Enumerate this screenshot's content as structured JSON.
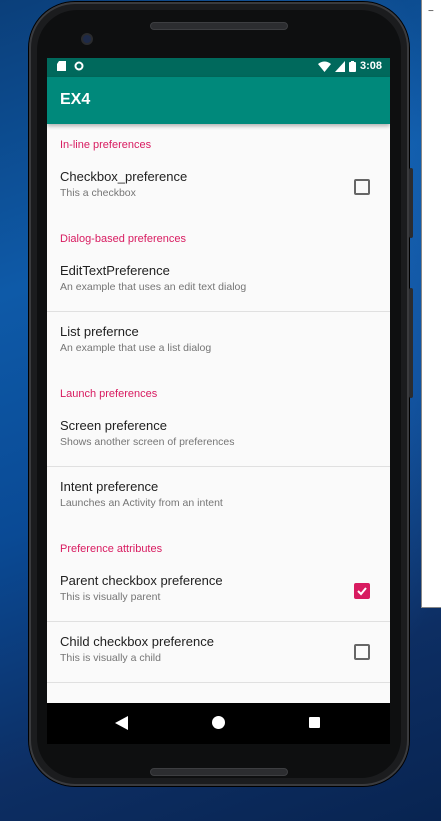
{
  "status_bar": {
    "time": "3:08"
  },
  "app_bar": {
    "title": "EX4"
  },
  "preferences": [
    {
      "type": "category",
      "label": "In-line preferences"
    },
    {
      "type": "item",
      "title": "Checkbox_preference",
      "summary": "This a checkbox",
      "checkbox": true,
      "checked": false,
      "divider": false
    },
    {
      "type": "category",
      "label": "Dialog-based preferences"
    },
    {
      "type": "item",
      "title": "EditTextPreference",
      "summary": "An example that uses an edit text dialog",
      "checkbox": false,
      "divider": true
    },
    {
      "type": "item",
      "title": "List prefernce",
      "summary": "An example that use a list dialog",
      "checkbox": false,
      "divider": false
    },
    {
      "type": "category",
      "label": "Launch preferences"
    },
    {
      "type": "item",
      "title": "Screen preference",
      "summary": "Shows another screen of preferences",
      "checkbox": false,
      "divider": true
    },
    {
      "type": "item",
      "title": "Intent preference",
      "summary": "Launches an Activity from an intent",
      "checkbox": false,
      "divider": false
    },
    {
      "type": "category",
      "label": "Preference attributes"
    },
    {
      "type": "item",
      "title": "Parent checkbox preference",
      "summary": "This is visually parent",
      "checkbox": true,
      "checked": true,
      "divider": true
    },
    {
      "type": "item",
      "title": "Child checkbox preference",
      "summary": "This is visually a child",
      "checkbox": true,
      "checked": false,
      "divider": true
    }
  ],
  "nav_bar": {
    "back_icon": "back-triangle-icon",
    "home_icon": "home-circle-icon",
    "recents_icon": "recents-square-icon"
  },
  "colors": {
    "primary": "#00897b",
    "primary_dark": "#00695c",
    "accent": "#d81b60"
  }
}
